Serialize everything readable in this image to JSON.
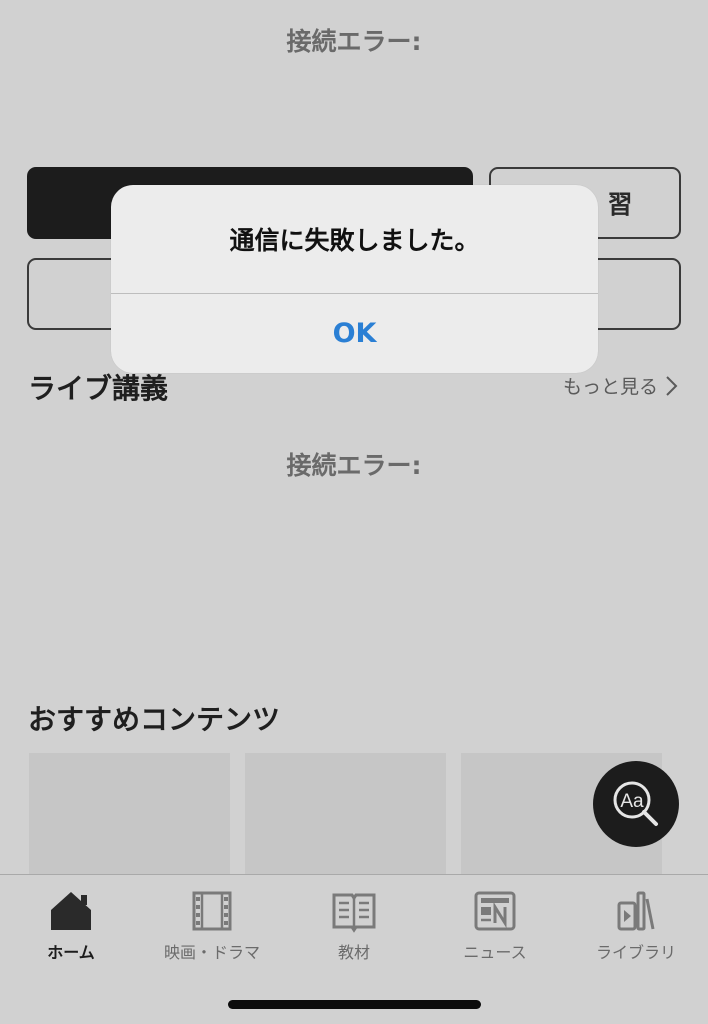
{
  "content": {
    "connection_error_top": "接続エラー:",
    "connection_error_live": "接続エラー:",
    "review_button_partial": "習",
    "live_section_title": "ライブ講義",
    "see_more_label": "もっと見る",
    "recommended_title": "おすすめコンテンツ"
  },
  "fab": {
    "label": "Aa",
    "icon": "font-search-icon"
  },
  "tabs": [
    {
      "label": "ホーム",
      "icon": "home-icon",
      "active": true
    },
    {
      "label": "映画・ドラマ",
      "icon": "film-icon",
      "active": false
    },
    {
      "label": "教材",
      "icon": "book-icon",
      "active": false
    },
    {
      "label": "ニュース",
      "icon": "newspaper-icon",
      "active": false
    },
    {
      "label": "ライブラリ",
      "icon": "library-icon",
      "active": false
    }
  ],
  "alert": {
    "message": "通信に失敗しました。",
    "ok_label": "OK"
  },
  "colors": {
    "accent": "#2a7fd4",
    "background_dimmed": "#d1d1d1",
    "dark": "#1c1c1c"
  }
}
